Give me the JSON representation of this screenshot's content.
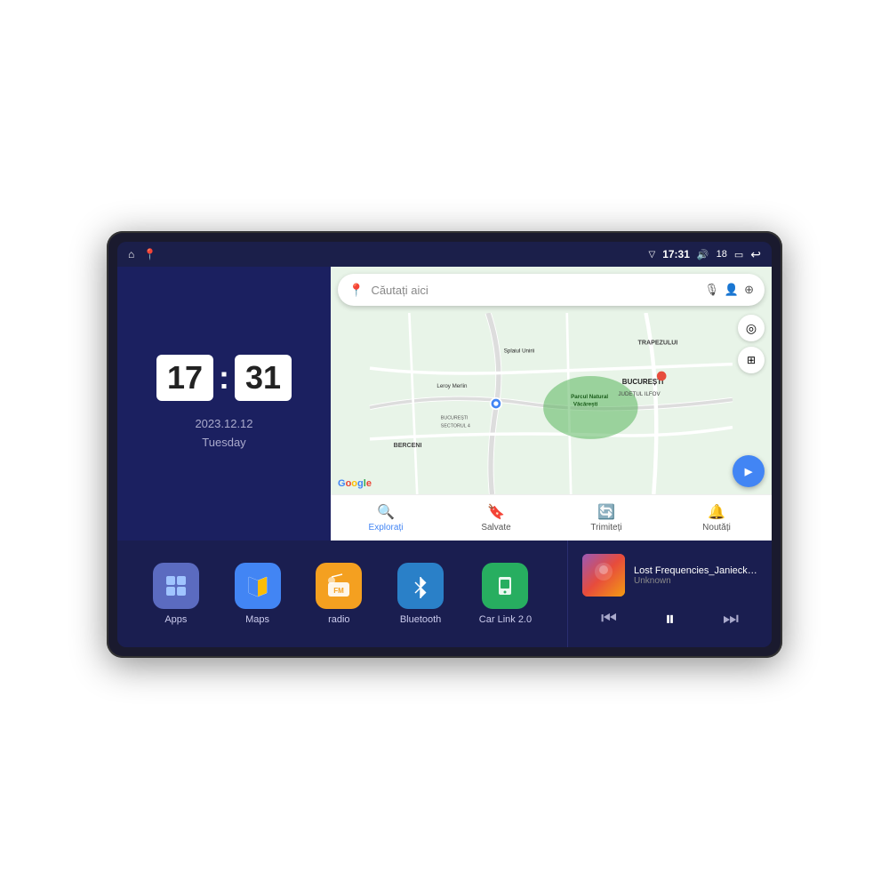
{
  "device": {
    "screen": {
      "status_bar": {
        "left_icons": [
          "home",
          "location"
        ],
        "time": "17:31",
        "signal_icon": "signal",
        "volume_icon": "volume",
        "battery_level": "18",
        "battery_icon": "battery",
        "back_icon": "back"
      },
      "clock_panel": {
        "hour": "17",
        "minute": "31",
        "date": "2023.12.12",
        "day": "Tuesday"
      },
      "map_panel": {
        "search_placeholder": "Căutați aici",
        "nav_items": [
          {
            "label": "Explorați",
            "icon": "🔍",
            "active": true
          },
          {
            "label": "Salvate",
            "icon": "🔖",
            "active": false
          },
          {
            "label": "Trimiteți",
            "icon": "🔄",
            "active": false
          },
          {
            "label": "Noutăți",
            "icon": "🔔",
            "active": false
          }
        ],
        "locations": {
          "trapezului": "TRAPEZULUI",
          "bucuresti": "BUCUREȘTI",
          "judetul_ilfov": "JUDEȚUL ILFOV",
          "berceni": "BERCENI",
          "parcul": "Parcul Natural Văcărești",
          "leroy_merlin": "Leroy Merlin",
          "bucuresti_sector4": "BUCUREȘTI\nSECTORUL 4",
          "splaiul_unirii": "Splaiul Unirii"
        }
      },
      "apps": [
        {
          "name": "Apps",
          "icon": "⊞",
          "color": "#5b6bc0"
        },
        {
          "name": "Maps",
          "icon": "📍",
          "color": "#4285f4"
        },
        {
          "name": "radio",
          "icon": "📻",
          "color": "#f4a020"
        },
        {
          "name": "Bluetooth",
          "icon": "🦷",
          "color": "#2a80c8"
        },
        {
          "name": "Car Link 2.0",
          "icon": "📱",
          "color": "#27ae60"
        }
      ],
      "music": {
        "title": "Lost Frequencies_Janieck Devy-...",
        "artist": "Unknown",
        "controls": {
          "prev": "⏮",
          "play": "⏸",
          "next": "⏭"
        }
      }
    }
  }
}
